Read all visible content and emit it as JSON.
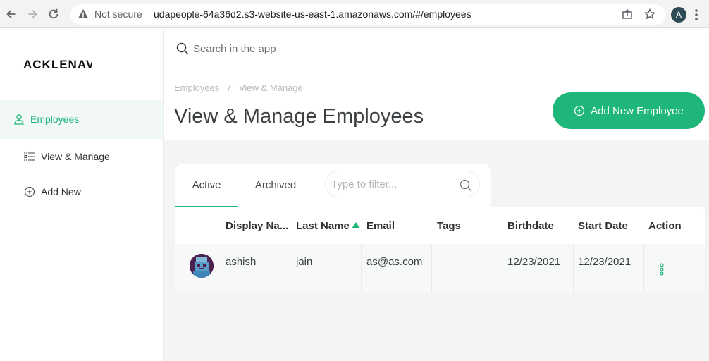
{
  "browser": {
    "security_label": "Not secure",
    "url": "udapeople-64a36d2.s3-website-us-east-1.amazonaws.com/#/employees",
    "profile_initial": "A"
  },
  "app": {
    "logo_text": "ACKLENAV",
    "search_placeholder": "Search in the app"
  },
  "sidebar": {
    "items": [
      {
        "label": "Employees",
        "icon": "user-icon",
        "active": true
      },
      {
        "label": "View & Manage",
        "icon": "list-icon",
        "active": false
      },
      {
        "label": "Add New",
        "icon": "plus-circle-icon",
        "active": false
      }
    ]
  },
  "header": {
    "breadcrumb": [
      "Employees",
      "/",
      "View & Manage"
    ],
    "title": "View & Manage Employees",
    "add_button_label": "Add New Employee"
  },
  "tabs": [
    {
      "label": "Active",
      "active": true
    },
    {
      "label": "Archived",
      "active": false
    }
  ],
  "filter": {
    "placeholder": "Type to filter..."
  },
  "table": {
    "columns": [
      "Display Na...",
      "Last Name",
      "Email",
      "Tags",
      "Birthdate",
      "Start Date",
      "Action"
    ],
    "sorted_column": "Last Name",
    "rows": [
      {
        "display_name": "ashish",
        "last_name": "jain",
        "email": "as@as.com",
        "tags": "",
        "birthdate": "12/23/2021",
        "start_date": "12/23/2021"
      }
    ]
  },
  "colors": {
    "accent": "#1fb679",
    "active_bg": "#f1f8f6"
  }
}
